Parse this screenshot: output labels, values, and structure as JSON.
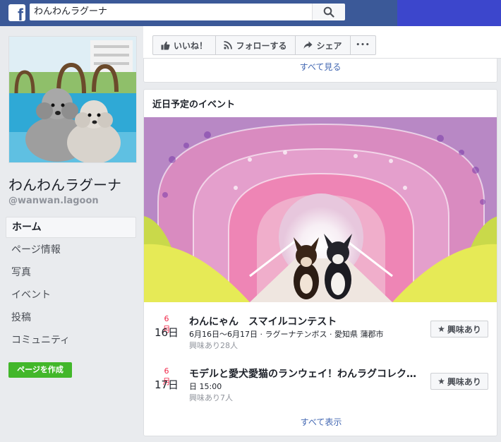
{
  "header": {
    "logo": "f",
    "search_value": "わんわんラグーナ"
  },
  "sidebar": {
    "page_name": "わんわんラグーナ",
    "page_handle": "@wanwan.lagoon",
    "nav": [
      {
        "label": "ホーム",
        "active": true
      },
      {
        "label": "ページ情報"
      },
      {
        "label": "写真"
      },
      {
        "label": "イベント"
      },
      {
        "label": "投稿"
      },
      {
        "label": "コミュニティ"
      }
    ],
    "create_page_label": "ページを作成"
  },
  "actions": {
    "like_label": "いいね！",
    "follow_label": "フォローする",
    "share_label": "シェア",
    "more_label": "•••"
  },
  "prev_card": {
    "see_all_label": "すべて見る"
  },
  "events": {
    "title": "近日予定のイベント",
    "items": [
      {
        "month": "6月",
        "day": "16日",
        "name": "わんにゃん　スマイルコンテスト",
        "detail": "6月16日～6月17日 · ラグーナテンボス · 愛知県 蒲郡市",
        "interest": "興味あり28人",
        "button_label": "興味あり"
      },
      {
        "month": "6月",
        "day": "17日",
        "name": "モデルと愛犬愛猫のランウェイ！わんラグコレクション",
        "detail": "日 15:00",
        "interest": "興味あり7人",
        "button_label": "興味あり"
      }
    ],
    "see_all_label": "すべて表示"
  },
  "colors": {
    "topbar": "#3b5998",
    "link": "#4267b2",
    "month_red": "#f02849",
    "create_green": "#42b72a"
  }
}
